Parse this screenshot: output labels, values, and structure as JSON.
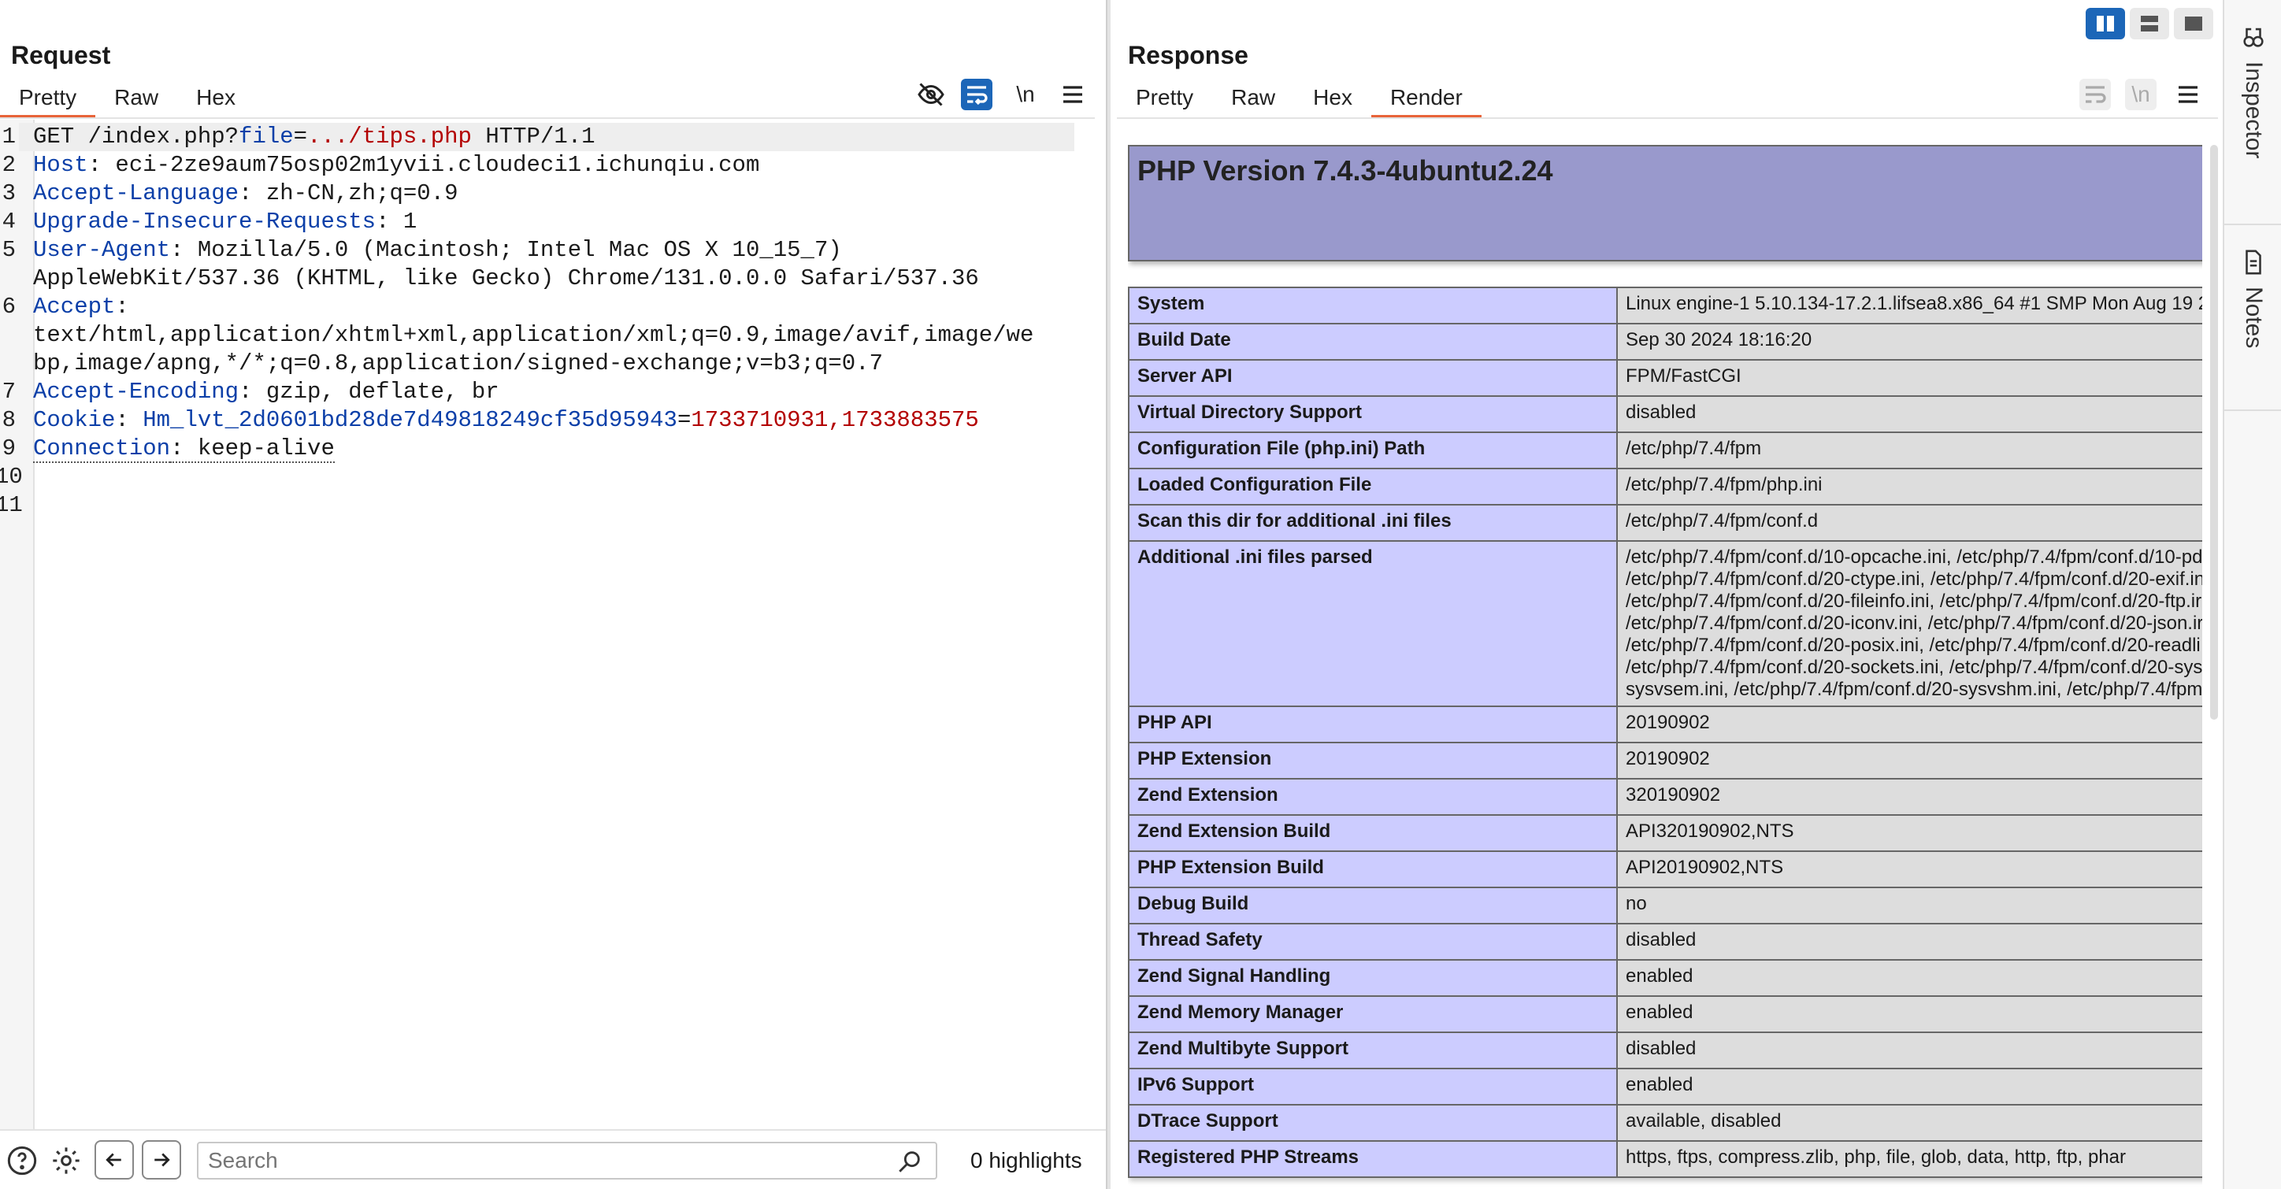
{
  "request": {
    "title": "Request",
    "tabs": [
      "Pretty",
      "Raw",
      "Hex"
    ],
    "active_tab": "Pretty",
    "toolbar_newline_label": "\\n",
    "lines": [
      {
        "n": "1",
        "parts": [
          {
            "t": "GET /index.php?",
            "c": ""
          },
          {
            "t": "file",
            "c": "kw"
          },
          {
            "t": "=",
            "c": ""
          },
          {
            "t": ".../tips.php",
            "c": "val-red"
          },
          {
            "t": " HTTP/1.1",
            "c": ""
          }
        ]
      },
      {
        "n": "2",
        "parts": [
          {
            "t": "Host",
            "c": "hn"
          },
          {
            "t": ": eci-2ze9aum75osp02m1yvii.cloudeci1.ichunqiu.com",
            "c": ""
          }
        ]
      },
      {
        "n": "3",
        "parts": [
          {
            "t": "Accept-Language",
            "c": "hn"
          },
          {
            "t": ": zh-CN,zh;q=0.9",
            "c": ""
          }
        ]
      },
      {
        "n": "4",
        "parts": [
          {
            "t": "Upgrade-Insecure-Requests",
            "c": "hn"
          },
          {
            "t": ": 1",
            "c": ""
          }
        ]
      },
      {
        "n": "5",
        "parts": [
          {
            "t": "User-Agent",
            "c": "hn"
          },
          {
            "t": ": Mozilla/5.0 (Macintosh; Intel Mac OS X 10_15_7)",
            "c": ""
          }
        ]
      },
      {
        "n": "",
        "parts": [
          {
            "t": "AppleWebKit/537.36 (KHTML, like Gecko) Chrome/131.0.0.0 Safari/537.36",
            "c": ""
          }
        ]
      },
      {
        "n": "6",
        "parts": [
          {
            "t": "Accept",
            "c": "hn"
          },
          {
            "t": ":",
            "c": ""
          }
        ]
      },
      {
        "n": "",
        "parts": [
          {
            "t": "text/html,application/xhtml+xml,application/xml;q=0.9,image/avif,image/we",
            "c": ""
          }
        ]
      },
      {
        "n": "",
        "parts": [
          {
            "t": "bp,image/apng,*/*;q=0.8,application/signed-exchange;v=b3;q=0.7",
            "c": ""
          }
        ]
      },
      {
        "n": "7",
        "parts": [
          {
            "t": "Accept-Encoding",
            "c": "hn"
          },
          {
            "t": ": gzip, deflate, br",
            "c": ""
          }
        ]
      },
      {
        "n": "8",
        "parts": [
          {
            "t": "Cookie",
            "c": "hn"
          },
          {
            "t": ": ",
            "c": ""
          },
          {
            "t": "Hm_lvt_2d0601bd28de7d49818249cf35d95943",
            "c": "kw"
          },
          {
            "t": "=",
            "c": ""
          },
          {
            "t": "1733710931,1733883575",
            "c": "val-red"
          }
        ]
      },
      {
        "n": "9",
        "parts": [
          {
            "t": "Connection",
            "c": "hn dotted"
          },
          {
            "t": ": keep-alive",
            "c": "dotted"
          }
        ]
      },
      {
        "n": "10",
        "parts": []
      },
      {
        "n": "11",
        "parts": []
      }
    ],
    "search_placeholder": "Search",
    "highlights_label": "0 highlights"
  },
  "response": {
    "title": "Response",
    "tabs": [
      "Pretty",
      "Raw",
      "Hex",
      "Render"
    ],
    "active_tab": "Render",
    "toolbar_newline_label": "\\n",
    "php_title": "PHP Version 7.4.3-4ubuntu2.24",
    "rows": [
      {
        "k": "System",
        "v": [
          "Linux engine-1 5.10.134-17.2.1.lifsea8.x86_64 #1 SMP Mon Aug 19 2"
        ]
      },
      {
        "k": "Build Date",
        "v": [
          "Sep 30 2024 18:16:20"
        ]
      },
      {
        "k": "Server API",
        "v": [
          "FPM/FastCGI"
        ]
      },
      {
        "k": "Virtual Directory Support",
        "v": [
          "disabled"
        ]
      },
      {
        "k": "Configuration File (php.ini) Path",
        "v": [
          "/etc/php/7.4/fpm"
        ]
      },
      {
        "k": "Loaded Configuration File",
        "v": [
          "/etc/php/7.4/fpm/php.ini"
        ]
      },
      {
        "k": "Scan this dir for additional .ini files",
        "v": [
          "/etc/php/7.4/fpm/conf.d"
        ]
      },
      {
        "k": "Additional .ini files parsed",
        "v": [
          "/etc/php/7.4/fpm/conf.d/10-opcache.ini, /etc/php/7.4/fpm/conf.d/10-pd",
          "/etc/php/7.4/fpm/conf.d/20-ctype.ini, /etc/php/7.4/fpm/conf.d/20-exif.in",
          "/etc/php/7.4/fpm/conf.d/20-fileinfo.ini, /etc/php/7.4/fpm/conf.d/20-ftp.ir",
          "/etc/php/7.4/fpm/conf.d/20-iconv.ini, /etc/php/7.4/fpm/conf.d/20-json.ir",
          "/etc/php/7.4/fpm/conf.d/20-posix.ini, /etc/php/7.4/fpm/conf.d/20-readli",
          "/etc/php/7.4/fpm/conf.d/20-sockets.ini, /etc/php/7.4/fpm/conf.d/20-sys",
          "sysvsem.ini, /etc/php/7.4/fpm/conf.d/20-sysvshm.ini, /etc/php/7.4/fpm"
        ]
      },
      {
        "k": "PHP API",
        "v": [
          "20190902"
        ]
      },
      {
        "k": "PHP Extension",
        "v": [
          "20190902"
        ]
      },
      {
        "k": "Zend Extension",
        "v": [
          "320190902"
        ]
      },
      {
        "k": "Zend Extension Build",
        "v": [
          "API320190902,NTS"
        ]
      },
      {
        "k": "PHP Extension Build",
        "v": [
          "API20190902,NTS"
        ]
      },
      {
        "k": "Debug Build",
        "v": [
          "no"
        ]
      },
      {
        "k": "Thread Safety",
        "v": [
          "disabled"
        ]
      },
      {
        "k": "Zend Signal Handling",
        "v": [
          "enabled"
        ]
      },
      {
        "k": "Zend Memory Manager",
        "v": [
          "enabled"
        ]
      },
      {
        "k": "Zend Multibyte Support",
        "v": [
          "disabled"
        ]
      },
      {
        "k": "IPv6 Support",
        "v": [
          "enabled"
        ]
      },
      {
        "k": "DTrace Support",
        "v": [
          "available, disabled"
        ]
      },
      {
        "k": "Registered PHP Streams",
        "v": [
          "https, ftps, compress.zlib, php, file, glob, data, http, ftp, phar"
        ]
      }
    ]
  },
  "rail": {
    "inspector_label": "Inspector",
    "notes_label": "Notes"
  },
  "colors": {
    "accent_tab": "#e8643a",
    "php_header": "#9999cc",
    "php_key": "#ccccff",
    "php_value": "#dddddd",
    "layout_active": "#1c66b8"
  }
}
